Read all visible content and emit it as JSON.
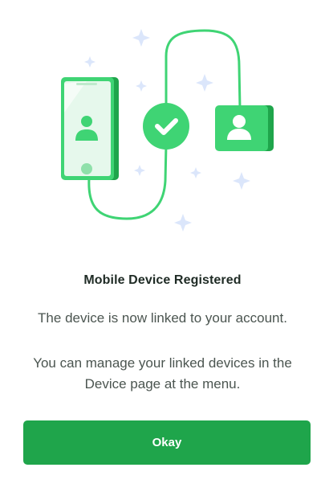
{
  "dialog": {
    "title": "Mobile Device Registered",
    "description": "The device is now linked to your account.",
    "hint": "You can manage your linked devices in the Device page at the menu.",
    "okay_label": "Okay"
  },
  "illustration": {
    "icons": [
      "mobile-phone-icon",
      "checkmark-icon",
      "user-card-icon",
      "sparkle-icon"
    ]
  },
  "colors": {
    "accent": "#1fa54b",
    "accent_light": "#3fd474",
    "sparkle": "#dbe6fb",
    "title_text": "#1f2b25",
    "body_text": "#4b5550"
  }
}
